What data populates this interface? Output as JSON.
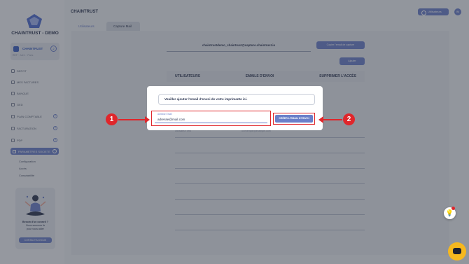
{
  "sidebar": {
    "brand": "CHAINTRUST - DEMO",
    "company": {
      "name": "CHAINTRUST",
      "badge": "2",
      "sub": "REF · Juil 1 · Paris"
    },
    "items": [
      {
        "label": "DEPOT",
        "icon": "upload-icon"
      },
      {
        "label": "MES FACTURES",
        "icon": "invoice-icon"
      },
      {
        "label": "BANQUE",
        "icon": "bank-icon"
      },
      {
        "label": "GED",
        "icon": "folder-icon"
      },
      {
        "label": "PLAN COMPTABLE",
        "icon": "ledger-icon"
      },
      {
        "label": "FACTURATION",
        "icon": "billing-icon"
      },
      {
        "label": "PDP",
        "icon": "pdp-icon"
      }
    ],
    "active_item": {
      "label": "PARAMETRES SOCIETE",
      "icon": "settings-icon"
    },
    "subitems": [
      "Configuration",
      "Accès",
      "Comptabilité"
    ],
    "help": {
      "text_line1": "Besoin d'un conseil ?",
      "text_line2": "Nous sommes là",
      "text_line3": "pour vous aider",
      "button": "CONTACTEZ-NOUS"
    }
  },
  "header": {
    "title": "CHAINTRUST",
    "button": "Utilisateurs",
    "avatar": "IM"
  },
  "tabs": [
    {
      "label": "Utilisateurs",
      "active": false
    },
    {
      "label": "Capture Mail",
      "active": true
    }
  ],
  "capture": {
    "email": "chaintrustdemo_chaintrust@capture.chaintrust.io",
    "copy_button": "Copier l'email de capture",
    "add_button": "Ajouter"
  },
  "table": {
    "headers": [
      "UTILISATEURS",
      "EMAILS D'ENVOI",
      "SUPPRIMER L'ACCÈS"
    ],
    "ghost_row": [
      "Utilisateur Test",
      "ut-exemple@example.com"
    ]
  },
  "modal": {
    "message": "Veuiller ajouter l'email d'envoi de votre imprimante ici.",
    "field_label": "Adresse Email",
    "field_value": "adresse@mail.com",
    "create_button": "CRÉER L'EMAIL D'ENVOI"
  },
  "callouts": {
    "one": "1",
    "two": "2"
  },
  "colors": {
    "accent": "#6a7fc9",
    "annotation": "#e0262b",
    "chat": "#f6b81f"
  }
}
